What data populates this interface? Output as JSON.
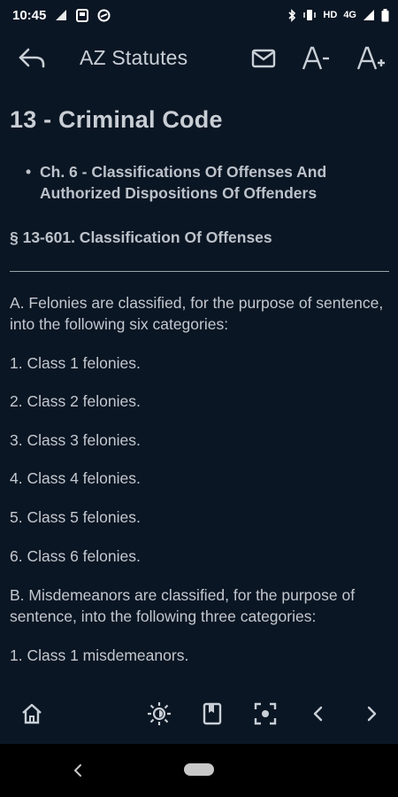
{
  "status_bar": {
    "time": "10:45",
    "hd_label": "HD",
    "network_label": "4G"
  },
  "app_bar": {
    "title": "AZ Statutes"
  },
  "statute": {
    "title": "13 - Criminal Code",
    "chapter_bullet": "•",
    "chapter": "Ch. 6 - Classifications Of Offenses And Authorized Dispositions Of Offenders",
    "section": "§ 13-601. Classification Of Offenses"
  },
  "paragraphs": [
    "A. Felonies are classified, for the purpose of sentence, into the following six categories:",
    "1. Class 1 felonies.",
    "2. Class 2 felonies.",
    "3. Class 3 felonies.",
    "4. Class 4 felonies.",
    "5. Class 5 felonies.",
    "6. Class 6 felonies.",
    "B. Misdemeanors are classified, for the purpose of sentence, into the following three categories:",
    "1. Class 1 misdemeanors."
  ],
  "icons": {
    "back": "back-arrow-icon",
    "mail": "mail-icon",
    "font_down": "font-decrease-icon",
    "font_up": "font-increase-icon",
    "home": "home-icon",
    "brightness": "brightness-icon",
    "bookmark": "bookmark-icon",
    "focus": "focus-icon",
    "prev": "chevron-left-icon",
    "next": "chevron-right-icon"
  },
  "colors": {
    "background": "#0b1624",
    "text": "#c3c8cf",
    "nav_bar": "#000000"
  }
}
